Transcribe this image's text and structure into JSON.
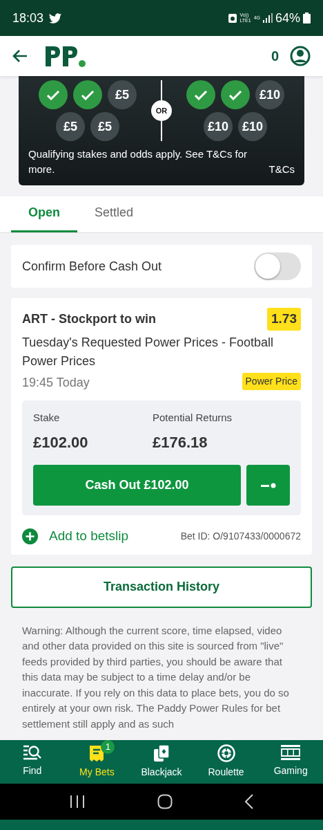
{
  "status_bar": {
    "time": "18:03",
    "network": [
      "Vo))",
      "LTE1",
      "4G"
    ],
    "battery": "64%"
  },
  "header": {
    "balance": "0"
  },
  "promo": {
    "groups": [
      {
        "circles": [
          {
            "kind": "check"
          },
          {
            "kind": "check"
          },
          {
            "kind": "stake",
            "text": "£5"
          },
          {
            "kind": "stake",
            "text": "£5"
          },
          {
            "kind": "stake",
            "text": "£5"
          }
        ]
      },
      {
        "circles": [
          {
            "kind": "check"
          },
          {
            "kind": "check"
          },
          {
            "kind": "stake",
            "text": "£10"
          },
          {
            "kind": "stake",
            "text": "£10"
          },
          {
            "kind": "stake",
            "text": "£10"
          }
        ]
      }
    ],
    "divider": "OR",
    "note": "Qualifying stakes and odds apply. See T&Cs for more.",
    "link": "T&Cs"
  },
  "tabs": [
    {
      "label": "Open",
      "selected": true
    },
    {
      "label": "Settled",
      "selected": false
    }
  ],
  "confirm": {
    "label": "Confirm Before Cash Out",
    "on": false
  },
  "bet": {
    "selection": "ART - Stockport to win",
    "odds": "1.73",
    "market": "Tuesday's Requested Power Prices - Football Power Prices",
    "time": "19:45 Today",
    "badge": "Power Price",
    "stake_label": "Stake",
    "stake": "£102.00",
    "returns_label": "Potential Returns",
    "returns": "£176.18",
    "cash_out": "Cash Out £102.00",
    "add": "Add to betslip",
    "bet_id": "Bet ID: O/9107433/0000672"
  },
  "transaction_button": "Transaction History",
  "warning": "Warning: Although the current score, time elapsed, video and other data provided on this site is sourced from \"live\" feeds provided by third parties, you should be aware that this data may be subject to a time delay and/or be inaccurate. If you rely on this data to place bets, you do so entirely at your own risk. The Paddy Power Rules for bet settlement still apply and as such",
  "nav": [
    {
      "label": "Find",
      "kind": "find",
      "selected": false
    },
    {
      "label": "My Bets",
      "kind": "bets",
      "selected": true,
      "badge": "1"
    },
    {
      "label": "Blackjack",
      "kind": "cards",
      "selected": false
    },
    {
      "label": "Roulette",
      "kind": "wheel",
      "selected": false
    },
    {
      "label": "Gaming",
      "kind": "slots",
      "selected": false
    }
  ]
}
